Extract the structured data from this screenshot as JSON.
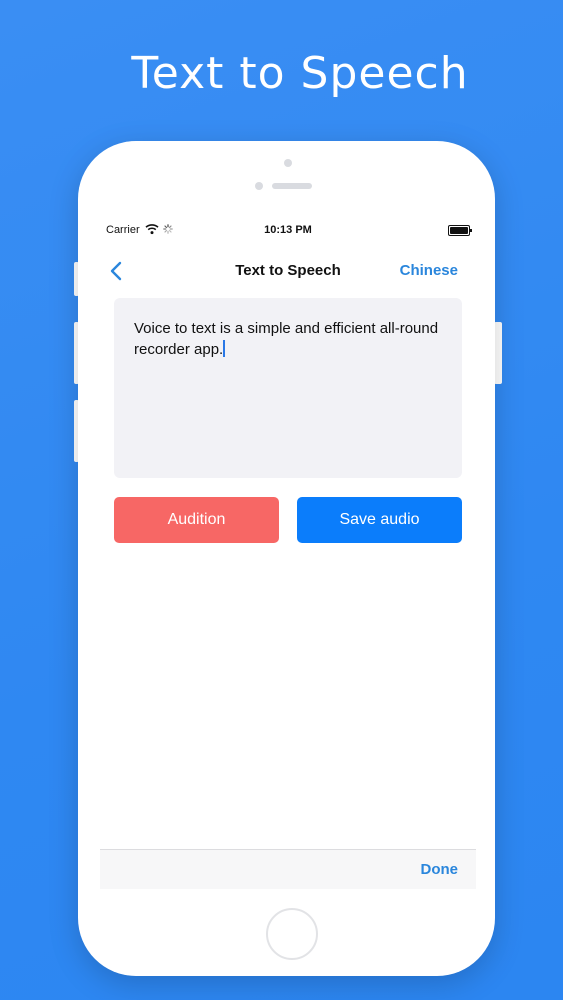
{
  "hero": {
    "title": "Text to Speech"
  },
  "status_bar": {
    "carrier": "Carrier",
    "time": "10:13 PM"
  },
  "nav": {
    "title": "Text to Speech",
    "language_button": "Chinese"
  },
  "editor": {
    "text": "Voice to text is a simple and efficient all-round recorder app."
  },
  "buttons": {
    "audition": "Audition",
    "save_audio": "Save audio"
  },
  "toolbar": {
    "done": "Done"
  },
  "colors": {
    "background": "#3a8ef3",
    "accent_blue": "#0b7dfb",
    "audition_red": "#f76765",
    "link_blue": "#2a86dc"
  },
  "icons": [
    "back-chevron-icon",
    "wifi-icon",
    "activity-spinner-icon",
    "battery-icon"
  ]
}
